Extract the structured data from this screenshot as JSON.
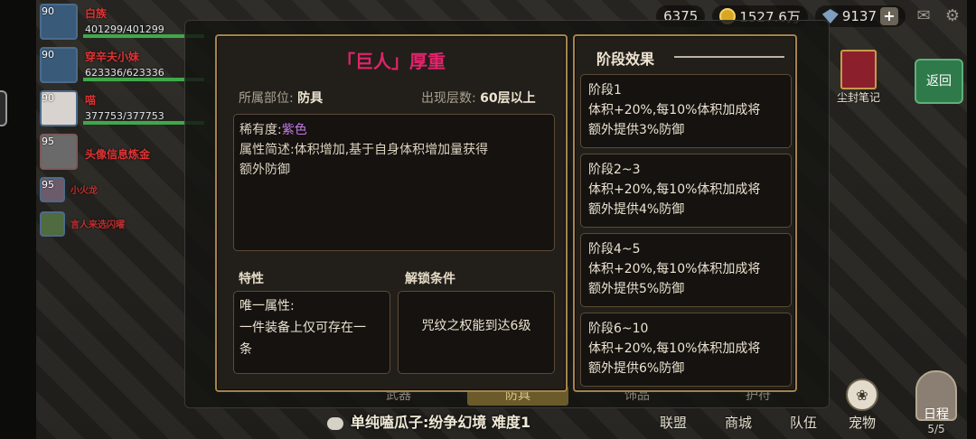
{
  "party": [
    {
      "level": "90",
      "name": "白族",
      "hp": "401299/401299",
      "style": "blue"
    },
    {
      "level": "90",
      "name": "穿辛夫小妹",
      "hp": "623336/623336",
      "style": "blue"
    },
    {
      "level": "90",
      "name": "喵",
      "hp": "377753/377753",
      "style": "white"
    },
    {
      "level": "95",
      "name": "头像信息炼金",
      "hp": "",
      "style": "gray"
    },
    {
      "level": "95",
      "name": "小火龙",
      "hp": "",
      "style": "small"
    },
    {
      "level": "",
      "name": "言人来选闪曜",
      "hp": "",
      "style": "small"
    }
  ],
  "topbar": {
    "stat1": "6375",
    "gold": "1527.6万",
    "gems": "9137",
    "plus": "+"
  },
  "side": {
    "book_label": "尘封笔记",
    "back_label": "返回"
  },
  "bottom": {
    "chat": "单纯嗑瓜子:纷争幻境 难度1",
    "nav": [
      "联盟",
      "商城",
      "队伍"
    ],
    "pet_label": "宠物",
    "schedule_label": "日程",
    "schedule_count": "5/5"
  },
  "backplate": {
    "tab_left": "武器",
    "tab_selected": "防具",
    "tab_mid": "饰品",
    "tab_right": "护符"
  },
  "detail": {
    "title": "「巨人」厚重",
    "slot_label": "所属部位:",
    "slot_value": "防具",
    "floor_label": "出现层数:",
    "floor_value": "60层以上",
    "rarity_label": "稀有度:",
    "rarity_value": "紫色",
    "desc_line1": "属性简述:体积增加,基于自身体积增加量获得",
    "desc_line2": "额外防御",
    "trait_title": "特性",
    "trait_lines": [
      "唯一属性:",
      "一件装备上仅可存在一",
      "条"
    ],
    "unlock_title": "解锁条件",
    "unlock_text": "咒纹之权能到达6级"
  },
  "stages": {
    "title": "阶段效果",
    "items": [
      {
        "name": "阶段1",
        "line1": "体积+20%,每10%体积加成将",
        "line2": "额外提供3%防御"
      },
      {
        "name": "阶段2~3",
        "line1": "体积+20%,每10%体积加成将",
        "line2": "额外提供4%防御"
      },
      {
        "name": "阶段4~5",
        "line1": "体积+20%,每10%体积加成将",
        "line2": "额外提供5%防御"
      },
      {
        "name": "阶段6~10",
        "line1": "体积+20%,每10%体积加成将",
        "line2": "额外提供6%防御"
      }
    ]
  },
  "colors": {
    "title": "#e0246a",
    "rarity_purple": "#c57ae6",
    "panel_border": "#a5834e"
  },
  "icons": [
    "coin-icon",
    "gem-icon",
    "mail-icon",
    "gear-icon",
    "chat-icon",
    "pet-paw-icon",
    "book-icon"
  ]
}
